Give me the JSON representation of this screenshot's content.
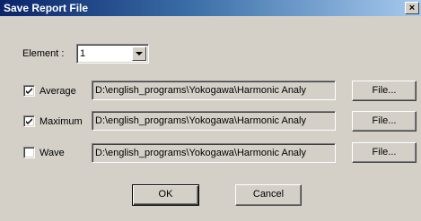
{
  "window": {
    "title": "Save Report File",
    "close_glyph": "×"
  },
  "element": {
    "label": "Element :",
    "value": "1"
  },
  "rows": [
    {
      "label": "Average",
      "checked": true,
      "path": "D:\\english_programs\\Yokogawa\\Harmonic Analy",
      "button": "File..."
    },
    {
      "label": "Maximum",
      "checked": true,
      "path": "D:\\english_programs\\Yokogawa\\Harmonic Analy",
      "button": "File..."
    },
    {
      "label": "Wave",
      "checked": false,
      "path": "D:\\english_programs\\Yokogawa\\Harmonic Analy",
      "button": "File..."
    }
  ],
  "buttons": {
    "ok": "OK",
    "cancel": "Cancel"
  }
}
